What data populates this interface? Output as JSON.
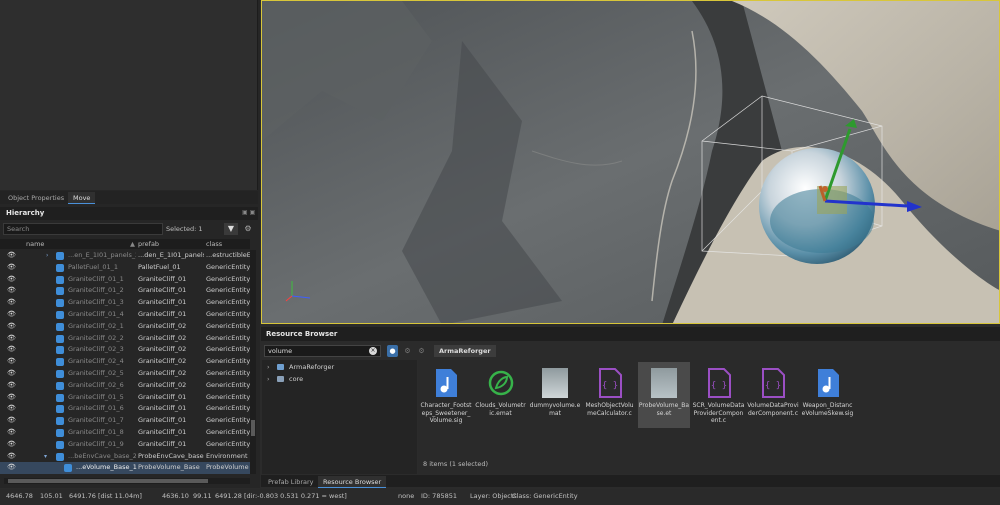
{
  "props_tabs": [
    "Object Properties",
    "Move"
  ],
  "hierarchy": {
    "title": "Hierarchy",
    "search_placeholder": "Search",
    "selected": "Selected: 1",
    "columns": {
      "name": "name",
      "prefab": "prefab",
      "class": "class"
    },
    "rows": [
      {
        "name": "...en_E_1I01_panels_2",
        "prefab": "...den_E_1I01_panels",
        "class": "...estructibleE",
        "expandable": true
      },
      {
        "name": "PalletFuel_01_1",
        "prefab": "PalletFuel_01",
        "class": "GenericEntity"
      },
      {
        "name": "GraniteCliff_01_1",
        "prefab": "GraniteCliff_01",
        "class": "GenericEntity"
      },
      {
        "name": "GraniteCliff_01_2",
        "prefab": "GraniteCliff_01",
        "class": "GenericEntity"
      },
      {
        "name": "GraniteCliff_01_3",
        "prefab": "GraniteCliff_01",
        "class": "GenericEntity"
      },
      {
        "name": "GraniteCliff_01_4",
        "prefab": "GraniteCliff_01",
        "class": "GenericEntity"
      },
      {
        "name": "GraniteCliff_02_1",
        "prefab": "GraniteCliff_02",
        "class": "GenericEntity"
      },
      {
        "name": "GraniteCliff_02_2",
        "prefab": "GraniteCliff_02",
        "class": "GenericEntity"
      },
      {
        "name": "GraniteCliff_02_3",
        "prefab": "GraniteCliff_02",
        "class": "GenericEntity"
      },
      {
        "name": "GraniteCliff_02_4",
        "prefab": "GraniteCliff_02",
        "class": "GenericEntity"
      },
      {
        "name": "GraniteCliff_02_5",
        "prefab": "GraniteCliff_02",
        "class": "GenericEntity"
      },
      {
        "name": "GraniteCliff_02_6",
        "prefab": "GraniteCliff_02",
        "class": "GenericEntity"
      },
      {
        "name": "GraniteCliff_01_5",
        "prefab": "GraniteCliff_01",
        "class": "GenericEntity"
      },
      {
        "name": "GraniteCliff_01_6",
        "prefab": "GraniteCliff_01",
        "class": "GenericEntity"
      },
      {
        "name": "GraniteCliff_01_7",
        "prefab": "GraniteCliff_01",
        "class": "GenericEntity"
      },
      {
        "name": "GraniteCliff_01_8",
        "prefab": "GraniteCliff_01",
        "class": "GenericEntity"
      },
      {
        "name": "GraniteCliff_01_9",
        "prefab": "GraniteCliff_01",
        "class": "GenericEntity"
      },
      {
        "name": "...beEnvCave_base_2",
        "prefab": "ProbeEnvCave_base",
        "class": "Environment",
        "expanded": true
      },
      {
        "name": "...eVolume_Base_1",
        "prefab": "ProbeVolume_Base",
        "class": "ProbeVolume",
        "selected": true
      }
    ]
  },
  "resource_browser": {
    "title": "Resource Browser",
    "search_value": "volume",
    "breadcrumb": "ArmaReforger",
    "tree": [
      {
        "label": "ArmaReforger"
      },
      {
        "label": "core"
      }
    ],
    "files": [
      {
        "name": "Character_Footsteps_Sweetener_Volume.sig",
        "icon": "music-note-icon",
        "color": "#3f7fd9"
      },
      {
        "name": "Clouds_Volumetric.emat",
        "icon": "leaf-icon",
        "color": "#37b34a"
      },
      {
        "name": "dummyvolume.emat",
        "icon": "material-thumbnail",
        "color": "#cfd6d8"
      },
      {
        "name": "MeshObjectVolumeCalculator.c",
        "icon": "script-icon",
        "color": "#9b4fc4"
      },
      {
        "name": "ProbeVolume_Base.et",
        "icon": "prefab-thumbnail",
        "color": "#b8c2c6",
        "selected": true
      },
      {
        "name": "SCR_VolumeDataProviderComponent.c",
        "icon": "script-icon",
        "color": "#9b4fc4"
      },
      {
        "name": "VolumeDataProviderComponent.c",
        "icon": "script-icon",
        "color": "#9b4fc4"
      },
      {
        "name": "Weapon_DistanceVolumeSkew.sig",
        "icon": "music-note-icon",
        "color": "#3f7fd9"
      }
    ],
    "count": "8 items (1 selected)"
  },
  "bottom_tabs": [
    "Prefab Library",
    "Resource Browser"
  ],
  "status": {
    "coords": "4646.78",
    "y": "105.01",
    "z": "6491.76",
    "dist": "[dist 11.04m]",
    "x2": "4636.10",
    "y2": "99.11",
    "z2dir": "6491.28 [dir:-0.803  0.531  0.271 = west]",
    "none": "none",
    "id": "ID: 785851",
    "layer": "Layer: Objects",
    "class": "Class: GenericEntity"
  },
  "colors": {
    "accent": "#4a90d9",
    "viewport_border": "#d8c63a",
    "selection": "#36485e"
  }
}
